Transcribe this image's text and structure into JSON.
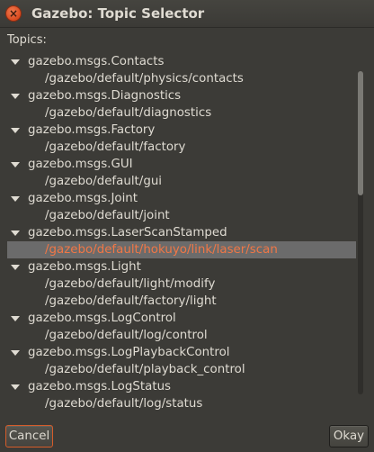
{
  "window": {
    "title": "Gazebo: Topic Selector",
    "close_icon": "close-icon",
    "accent_color": "#f07746"
  },
  "topics_label": "Topics:",
  "tree": [
    {
      "type": "parent",
      "label": "gazebo.msgs.Contacts"
    },
    {
      "type": "child",
      "label": "/gazebo/default/physics/contacts"
    },
    {
      "type": "parent",
      "label": "gazebo.msgs.Diagnostics"
    },
    {
      "type": "child",
      "label": "/gazebo/default/diagnostics"
    },
    {
      "type": "parent",
      "label": "gazebo.msgs.Factory"
    },
    {
      "type": "child",
      "label": "/gazebo/default/factory"
    },
    {
      "type": "parent",
      "label": "gazebo.msgs.GUI"
    },
    {
      "type": "child",
      "label": "/gazebo/default/gui"
    },
    {
      "type": "parent",
      "label": "gazebo.msgs.Joint"
    },
    {
      "type": "child",
      "label": "/gazebo/default/joint"
    },
    {
      "type": "parent",
      "label": "gazebo.msgs.LaserScanStamped"
    },
    {
      "type": "child",
      "label": "/gazebo/default/hokuyo/link/laser/scan",
      "selected": true
    },
    {
      "type": "parent",
      "label": "gazebo.msgs.Light"
    },
    {
      "type": "child",
      "label": "/gazebo/default/light/modify"
    },
    {
      "type": "child",
      "label": "/gazebo/default/factory/light"
    },
    {
      "type": "parent",
      "label": "gazebo.msgs.LogControl"
    },
    {
      "type": "child",
      "label": "/gazebo/default/log/control"
    },
    {
      "type": "parent",
      "label": "gazebo.msgs.LogPlaybackControl"
    },
    {
      "type": "child",
      "label": "/gazebo/default/playback_control"
    },
    {
      "type": "parent",
      "label": "gazebo.msgs.LogStatus"
    },
    {
      "type": "child",
      "label": "/gazebo/default/log/status"
    }
  ],
  "buttons": {
    "cancel_label": "Cancel",
    "okay_label": "Okay"
  }
}
